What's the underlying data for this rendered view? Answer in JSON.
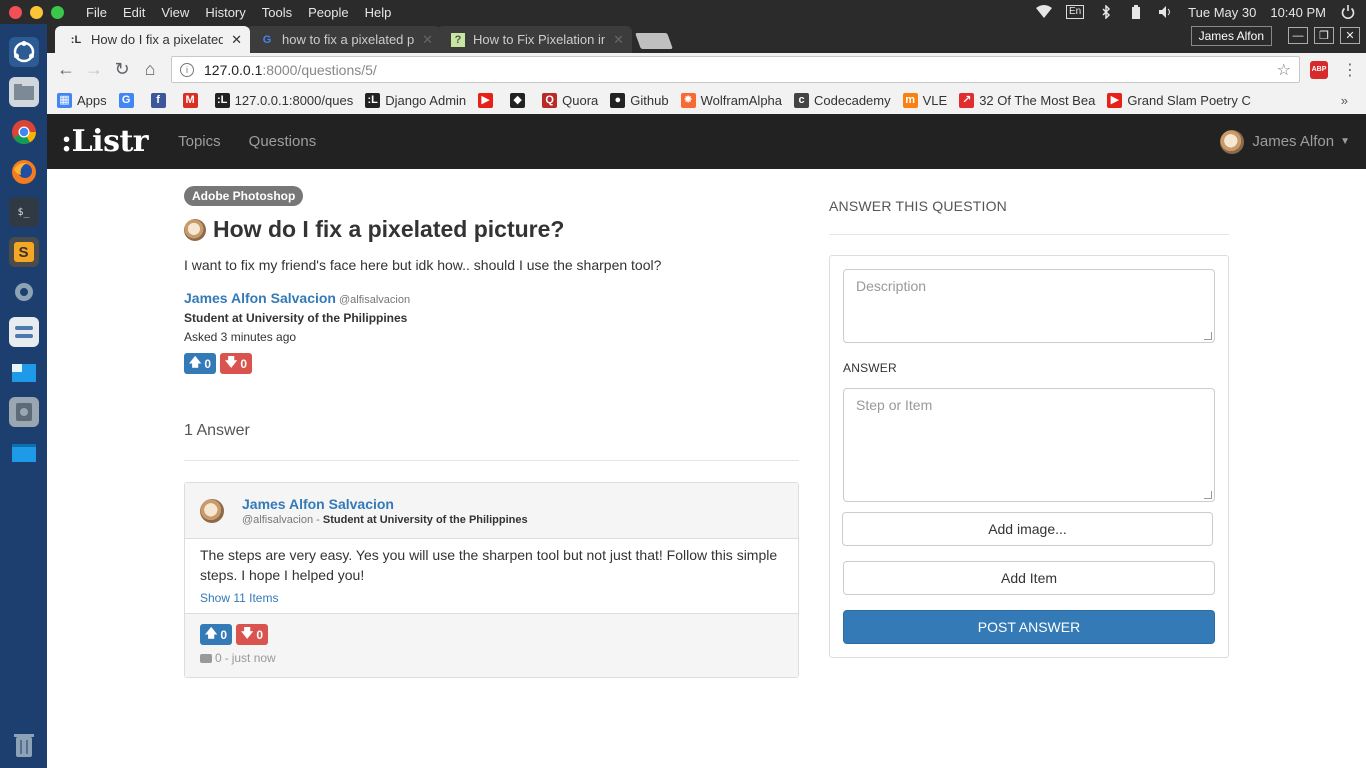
{
  "system": {
    "menu": [
      "File",
      "Edit",
      "View",
      "History",
      "Tools",
      "People",
      "Help"
    ],
    "lang": "En",
    "date": "Tue May 30",
    "time": "10:40 PM"
  },
  "browser": {
    "tabs": [
      {
        "title": "How do I fix a pixelated",
        "favicon": "listr-icon"
      },
      {
        "title": "how to fix a pixelated pi",
        "favicon": "google-icon"
      },
      {
        "title": "How to Fix Pixelation in",
        "favicon": "question-icon"
      }
    ],
    "profile": "James Alfon",
    "url_host": "127.0.0.1",
    "url_path": ":8000/questions/5/",
    "abp": "ABP",
    "bookmarks": [
      {
        "label": "Apps",
        "icon": "apps-icon",
        "color": "#4285f4"
      },
      {
        "label": "",
        "icon": "google-icon",
        "color": "#4285f4"
      },
      {
        "label": "",
        "icon": "facebook-icon",
        "color": "#3b5998"
      },
      {
        "label": "",
        "icon": "gmail-icon",
        "color": "#d93025"
      },
      {
        "label": "127.0.0.1:8000/ques",
        "icon": "listr-icon",
        "color": "#222"
      },
      {
        "label": "Django Admin",
        "icon": "listr-icon",
        "color": "#222"
      },
      {
        "label": "",
        "icon": "youtube-icon",
        "color": "#e62117"
      },
      {
        "label": "",
        "icon": "shield-icon",
        "color": "#222"
      },
      {
        "label": "Quora",
        "icon": "quora-icon",
        "color": "#b92b27"
      },
      {
        "label": "Github",
        "icon": "github-icon",
        "color": "#222"
      },
      {
        "label": "WolframAlpha",
        "icon": "wolfram-icon",
        "color": "#f96932"
      },
      {
        "label": "Codecademy",
        "icon": "codecademy-icon",
        "color": "#444"
      },
      {
        "label": "VLE",
        "icon": "moodle-icon",
        "color": "#f98012"
      },
      {
        "label": "32 Of The Most Bea",
        "icon": "trend-icon",
        "color": "#e02e2e"
      },
      {
        "label": "Grand Slam Poetry C",
        "icon": "youtube-icon",
        "color": "#e62117"
      }
    ]
  },
  "site": {
    "logo": ":Listr",
    "nav": [
      "Topics",
      "Questions"
    ],
    "user": "James Alfon"
  },
  "question": {
    "topic": "Adobe Photoshop",
    "title": "How do I fix a pixelated picture?",
    "description": "I want to fix my friend's face here but idk how.. should I use the sharpen tool?",
    "author_name": "James Alfon Salvacion",
    "author_handle": "@alfisalvacion",
    "occupation": "Student at University of the Philippines",
    "asked": "Asked 3 minutes ago",
    "upvotes": "0",
    "downvotes": "0"
  },
  "answers": {
    "heading": "1 Answer",
    "items": [
      {
        "author_name": "James Alfon Salvacion",
        "author_handle": "@alfisalvacion",
        "separator": " - ",
        "occupation": "Student at University of the Philippines",
        "text": "The steps are very easy. Yes you will use the sharpen tool but not just that! Follow this simple steps. I hope I helped you!",
        "show_items": "Show 11 Items",
        "upvotes": "0",
        "downvotes": "0",
        "comments": "0",
        "time": "just now"
      }
    ]
  },
  "answer_form": {
    "heading": "ANSWER THIS QUESTION",
    "description_placeholder": "Description",
    "answer_label": "ANSWER",
    "step_placeholder": "Step or Item",
    "add_image": "Add image...",
    "add_item": "Add Item",
    "post": "POST ANSWER"
  }
}
